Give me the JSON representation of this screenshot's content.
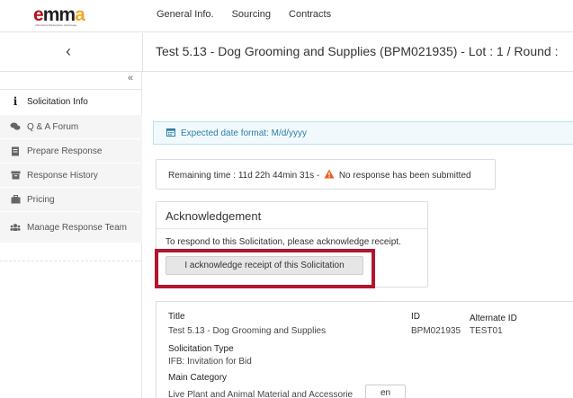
{
  "header": {
    "logo_text": "emma",
    "logo_tagline": "eMaryland Marketplace Advantage",
    "nav": [
      "General Info.",
      "Sourcing",
      "Contracts"
    ]
  },
  "titlebar": {
    "back_icon": "chevron-left-icon",
    "title": "Test 5.13 - Dog Grooming and Supplies (BPM021935) - Lot : 1 / Round :"
  },
  "sidebar": {
    "collapse_icon": "double-chevron-left-icon",
    "items": [
      {
        "label": "Solicitation Info",
        "icon": "info-icon",
        "active": true
      },
      {
        "label": "Q & A Forum",
        "icon": "comments-icon"
      },
      {
        "label": "Prepare Response",
        "icon": "document-icon"
      },
      {
        "label": "Response History",
        "icon": "archive-icon"
      },
      {
        "label": "Pricing",
        "icon": "briefcase-icon"
      },
      {
        "label": "Manage Response Team",
        "icon": "users-icon"
      }
    ]
  },
  "info_bar": {
    "icon": "calendar-icon",
    "text": "Expected date format: M/d/yyyy"
  },
  "remaining": {
    "prefix": "Remaining time : ",
    "time": "11d 22h 44min 31s",
    "sep": " - ",
    "status": "No response has been submitted",
    "warning_color": "#e8621a"
  },
  "acknowledgement": {
    "title": "Acknowledgement",
    "text": "To respond to this Solicitation, please acknowledge receipt.",
    "button": "I acknowledge receipt of this Solicitation",
    "highlight_color": "#b3152f"
  },
  "details": {
    "title_label": "Title",
    "title_value": "Test 5.13 - Dog Grooming and Supplies",
    "id_label": "ID",
    "id_value": "BPM021935",
    "alt_id_label": "Alternate ID",
    "alt_id_value": "TEST01",
    "type_label": "Solicitation Type",
    "type_value": "IFB: Invitation for Bid",
    "category_label": "Main Category",
    "category_value": "Live Plant and Animal Material and Accessorie",
    "lang_value": "en"
  }
}
